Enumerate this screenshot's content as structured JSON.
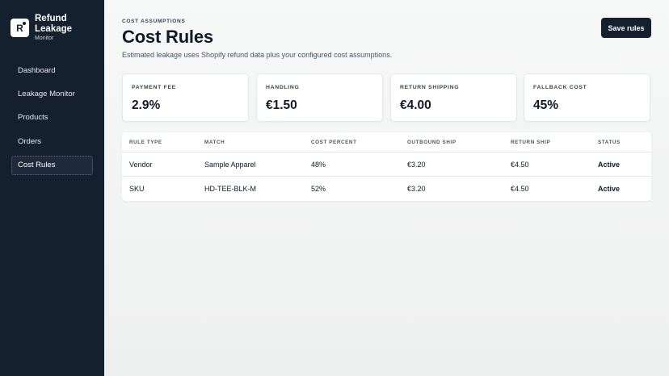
{
  "app": {
    "logo_letter": "R",
    "title": "Refund Leakage",
    "subtitle": "Monitor"
  },
  "sidebar": {
    "items": [
      {
        "label": "Dashboard",
        "active": false
      },
      {
        "label": "Leakage Monitor",
        "active": false
      },
      {
        "label": "Products",
        "active": false
      },
      {
        "label": "Orders",
        "active": false
      },
      {
        "label": "Cost Rules",
        "active": true
      }
    ]
  },
  "header": {
    "eyebrow": "COST ASSUMPTIONS",
    "title": "Cost Rules",
    "subtitle": "Estimated leakage uses Shopify refund data plus your configured cost assumptions.",
    "save_label": "Save rules"
  },
  "cards": [
    {
      "label": "PAYMENT FEE",
      "value": "2.9%"
    },
    {
      "label": "HANDLING",
      "value": "€1.50"
    },
    {
      "label": "RETURN SHIPPING",
      "value": "€4.00"
    },
    {
      "label": "FALLBACK COST",
      "value": "45%"
    }
  ],
  "table": {
    "headers": [
      "RULE TYPE",
      "MATCH",
      "COST PERCENT",
      "OUTBOUND SHIP",
      "RETURN SHIP",
      "STATUS"
    ],
    "rows": [
      {
        "rule_type": "Vendor",
        "match": "Sample Apparel",
        "cost_percent": "48%",
        "outbound_ship": "€3.20",
        "return_ship": "€4.50",
        "status": "Active"
      },
      {
        "rule_type": "SKU",
        "match": "HD-TEE-BLK-M",
        "cost_percent": "52%",
        "outbound_ship": "€3.20",
        "return_ship": "€4.50",
        "status": "Active"
      }
    ]
  },
  "colors": {
    "sidebar_bg": "#15202f",
    "primary_button": "#15202f",
    "page_bg": "#f3f4f4"
  }
}
